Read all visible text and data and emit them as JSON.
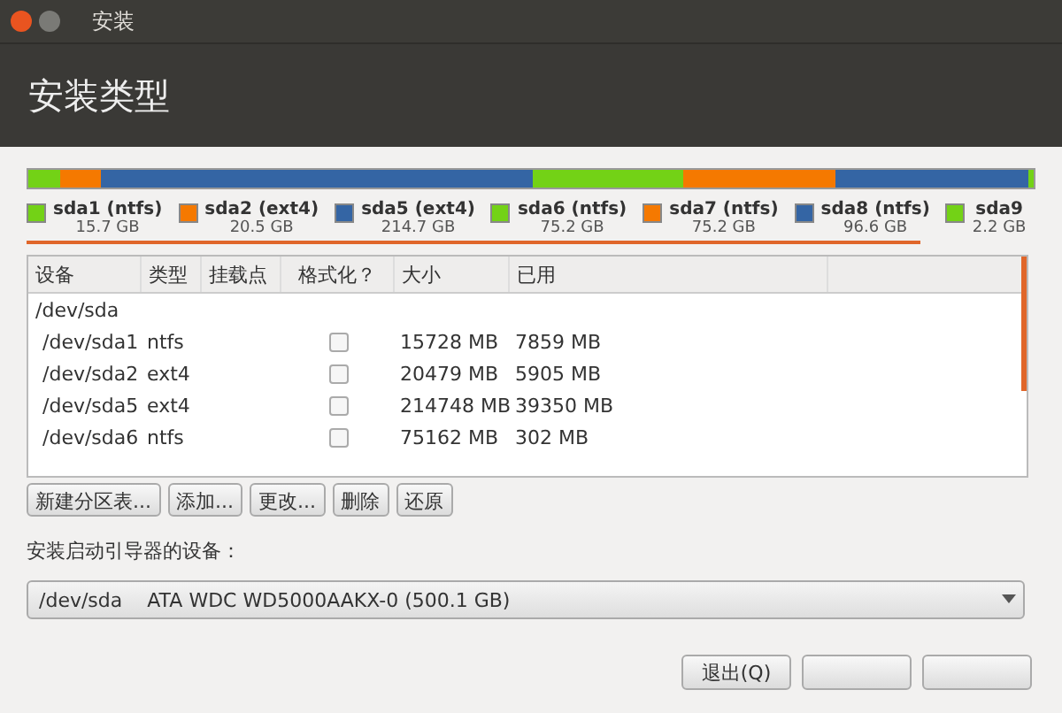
{
  "window": {
    "title": "安装类型"
  },
  "titlebar": {
    "title": "安装"
  },
  "partitions": [
    {
      "name": "sda1 (ntfs)",
      "size": "15.7 GB",
      "color": "#73d216"
    },
    {
      "name": "sda2 (ext4)",
      "size": "20.5 GB",
      "color": "#f57900"
    },
    {
      "name": "sda5 (ext4)",
      "size": "214.7 GB",
      "color": "#3465a4"
    },
    {
      "name": "sda6 (ntfs)",
      "size": "75.2 GB",
      "color": "#73d216"
    },
    {
      "name": "sda7 (ntfs)",
      "size": "75.2 GB",
      "color": "#f57900"
    },
    {
      "name": "sda8 (ntfs)",
      "size": "96.6 GB",
      "color": "#3465a4"
    },
    {
      "name": "sda9",
      "size": "2.2 GB",
      "color": "#73d216"
    }
  ],
  "table": {
    "columns": [
      "设备",
      "类型",
      "挂载点",
      "格式化？",
      "大小",
      "已用"
    ],
    "group": "/dev/sda",
    "rows": [
      {
        "device": "/dev/sda1",
        "type": "ntfs",
        "format": false,
        "size": "15728 MB",
        "used": "7859 MB"
      },
      {
        "device": "/dev/sda2",
        "type": "ext4",
        "format": false,
        "size": "20479 MB",
        "used": "5905 MB"
      },
      {
        "device": "/dev/sda5",
        "type": "ext4",
        "format": false,
        "size": "214748 MB",
        "used": "39350 MB"
      },
      {
        "device": "/dev/sda6",
        "type": "ntfs",
        "format": false,
        "size": "75162 MB",
        "used": "302 MB"
      }
    ]
  },
  "table_buttons": [
    "新建分区表...",
    "添加...",
    "更改...",
    "删除",
    "还原"
  ],
  "bootloader": {
    "label": "安装启动引导器的设备：",
    "device": "/dev/sda",
    "description": "ATA WDC WD5000AAKX-0 (500.1 GB)"
  },
  "footer_buttons": [
    "退出(Q)"
  ]
}
